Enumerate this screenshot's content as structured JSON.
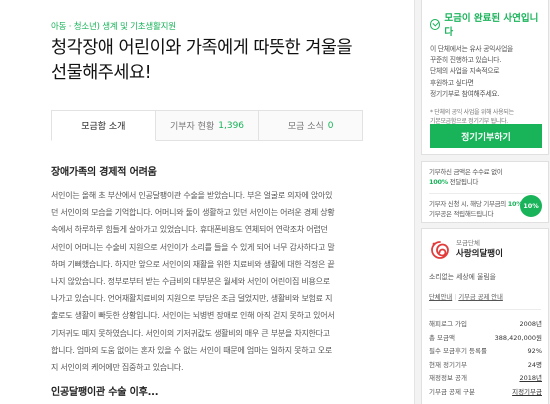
{
  "category": "아동 · 청소년) 생계 및 기초생활지원",
  "title_lines": [
    "청각장애 어린이와 가족에게 따뜻한 겨울을",
    "선물해주세요!"
  ],
  "tabs": [
    {
      "label": "모금함 소개",
      "count": ""
    },
    {
      "label": "기부자 현황",
      "count": "1,396"
    },
    {
      "label": "모금 소식",
      "count": "0"
    }
  ],
  "section1_title": "장애가족의 경제적 어려움",
  "body_lines": [
    "서인이는 올해 초 부산에서 인공달팽이관 수술을 받았습니다. 부은 얼굴로 의자에 앉아있",
    "던 서인이의 모습을 기억합니다. 어머니와 둘이 생활하고 있던 서인이는 어려운 경제 상황",
    "속에서 하루하루 힘들게 살아가고 있었습니다. 휴대폰비용도 연체되어 연락조차 어렵던",
    "서인이 어머니는 수술비 지원으로 서인이가 소리를 들을 수 있게 되어 너무 감사하다고 말",
    "하며 기뻐했습니다. 하지만 앞으로 서인이의 재활을 위한 치료비와 생활에 대한 걱정은 끝",
    "나지 않았습니다. 정부로부터 받는 수급비의 대부분은 월세와 서인이 어린이집 비용으로",
    "나가고 있습니다. 언어재활치료비의 지원으로 부담은 조금 덜었지만, 생활비와 보험료 지",
    "출로도 생활이 빠듯한 상황입니다. 서인이는 뇌병변 장애로 인해 아직 걷지 못하고 있어서",
    "기저귀도 떼지 못하였습니다. 서인이의 기저귀값도 생활비의 매우 큰 부분을 차지한다고",
    "합니다. 엄마의 도움 없이는 혼자 있을 수 없는 서인이 때문에 엄마는 일하지 못하고 오로",
    "지 서인이의 케어에만 집중하고 있습니다."
  ],
  "section2_title": "인공달팽이관 수술 이후...",
  "sidebar": {
    "done_title": "모금이 완료된 사연입니다",
    "done_lines": [
      "이 단체에서는 유사 공익사업을",
      "꾸준히 진행하고 있습니다.",
      "단체의 사업을 지속적으로",
      "후원하고 싶다면",
      "정기기부로 참여해주세요."
    ],
    "note_lines": [
      "* 단체의 공익 사업을 위해 사용되는",
      "기본모금함으로 정기기부 됩니다."
    ],
    "give_button": "정기기부하기",
    "delivery_line1": "기부하신 금액은 수수료 없이",
    "delivery_pct": "100%",
    "delivery_line2_suffix": " 전달됩니다",
    "tax_line1": "기부자 신청 시, 해당 기부금의",
    "tax_pct": "10%",
    "tax_line2": "기부공은 적립해드립니다",
    "circle_label": "10%",
    "org_small": "모금단체",
    "org_name": "사랑의달팽이",
    "org_desc": "소리없는 세상에 울림을",
    "org_link1": "단체안내",
    "org_link2": "기부금 공제 안내",
    "stats": [
      {
        "label": "해피로그 가입",
        "value": "2008년"
      },
      {
        "label": "총 모금액",
        "value": "388,420,000원"
      },
      {
        "label": "필수 모금후기 등록률",
        "value": "92%"
      },
      {
        "label": "현재 정기기부",
        "value": "24명"
      },
      {
        "label": "재정정보 공개",
        "value": "2018년"
      },
      {
        "label": "기부금 공제 구분",
        "value": "지정기부금"
      }
    ],
    "accent": "#19b35a"
  }
}
